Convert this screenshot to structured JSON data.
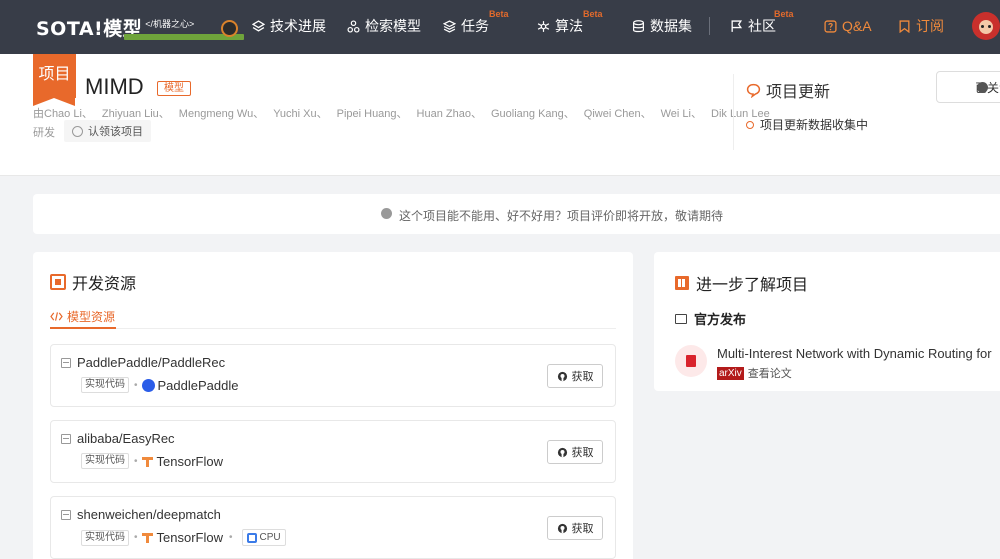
{
  "nav": {
    "logo": "SOTA!模型",
    "logo_sub": "</机器之心>",
    "items": [
      {
        "label": "技术进展",
        "beta": ""
      },
      {
        "label": "检索模型",
        "beta": ""
      },
      {
        "label": "任务",
        "beta": "Beta"
      },
      {
        "label": "算法",
        "beta": "Beta"
      },
      {
        "label": "数据集",
        "beta": ""
      },
      {
        "label": "社区",
        "beta": "Beta"
      },
      {
        "label": "Q&A",
        "beta": ""
      },
      {
        "label": "订阅",
        "beta": ""
      }
    ]
  },
  "project": {
    "tag": "项目",
    "title": "MIMD",
    "badge": "模型",
    "authors_prefix": "由",
    "authors": [
      "Chao Li、",
      "Zhiyuan Liu、",
      "Mengmeng Wu、",
      "Yuchi Xu、",
      "Pipei Huang、",
      "Huan Zhao、",
      "Guoliang Kang、",
      "Qiwei Chen、",
      "Wei Li、",
      "Dik Lun Lee"
    ],
    "field": "研发",
    "claim": "认领该项目"
  },
  "updates": {
    "title": "项目更新",
    "item": "项目更新数据收集中",
    "watch": "已关注"
  },
  "notice": "这个项目能不能用、好不好用？项目评价即将开放，敬请期待",
  "resources": {
    "title": "开发资源",
    "tab": "模型资源",
    "code_tag": "实现代码",
    "get_label": "获取",
    "cards": [
      {
        "repo": "PaddlePaddle/PaddleRec",
        "framework": "PaddlePaddle",
        "device": ""
      },
      {
        "repo": "alibaba/EasyRec",
        "framework": "TensorFlow",
        "device": ""
      },
      {
        "repo": "shenweichen/deepmatch",
        "framework": "TensorFlow",
        "device": "CPU"
      }
    ]
  },
  "learn_more": {
    "title": "进一步了解项目",
    "official": "官方发布",
    "paper_title": "Multi-Interest Network with Dynamic Routing for",
    "arxiv": "arXiv",
    "view_paper": "查看论文"
  }
}
